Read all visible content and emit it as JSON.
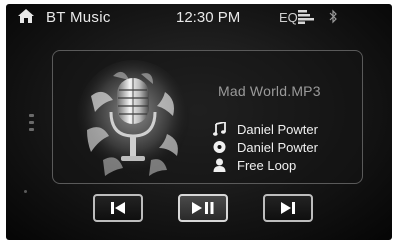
{
  "statusbar": {
    "home_icon": "home-icon",
    "title": "BT Music",
    "time": "12:30 PM",
    "eq_label": "EQ",
    "eq_icon": "equalizer-icon",
    "bt_icon": "bluetooth-icon"
  },
  "player": {
    "album_art": "microphone-album-art",
    "track_title": "Mad World.MP3",
    "song": {
      "icon": "music-note-icon",
      "text": "Daniel Powter"
    },
    "album": {
      "icon": "disc-icon",
      "text": "Daniel Powter"
    },
    "artist": {
      "icon": "person-icon",
      "text": "Free Loop"
    }
  },
  "controls": {
    "prev_icon": "previous-track-icon",
    "play_pause_icon": "play-pause-icon",
    "next_icon": "next-track-icon",
    "active": "play-pause"
  },
  "colors": {
    "background": "#161616",
    "text": "#f0f0f0",
    "title_gray": "#9a9a9a",
    "button_border": "#bdbdbd"
  }
}
